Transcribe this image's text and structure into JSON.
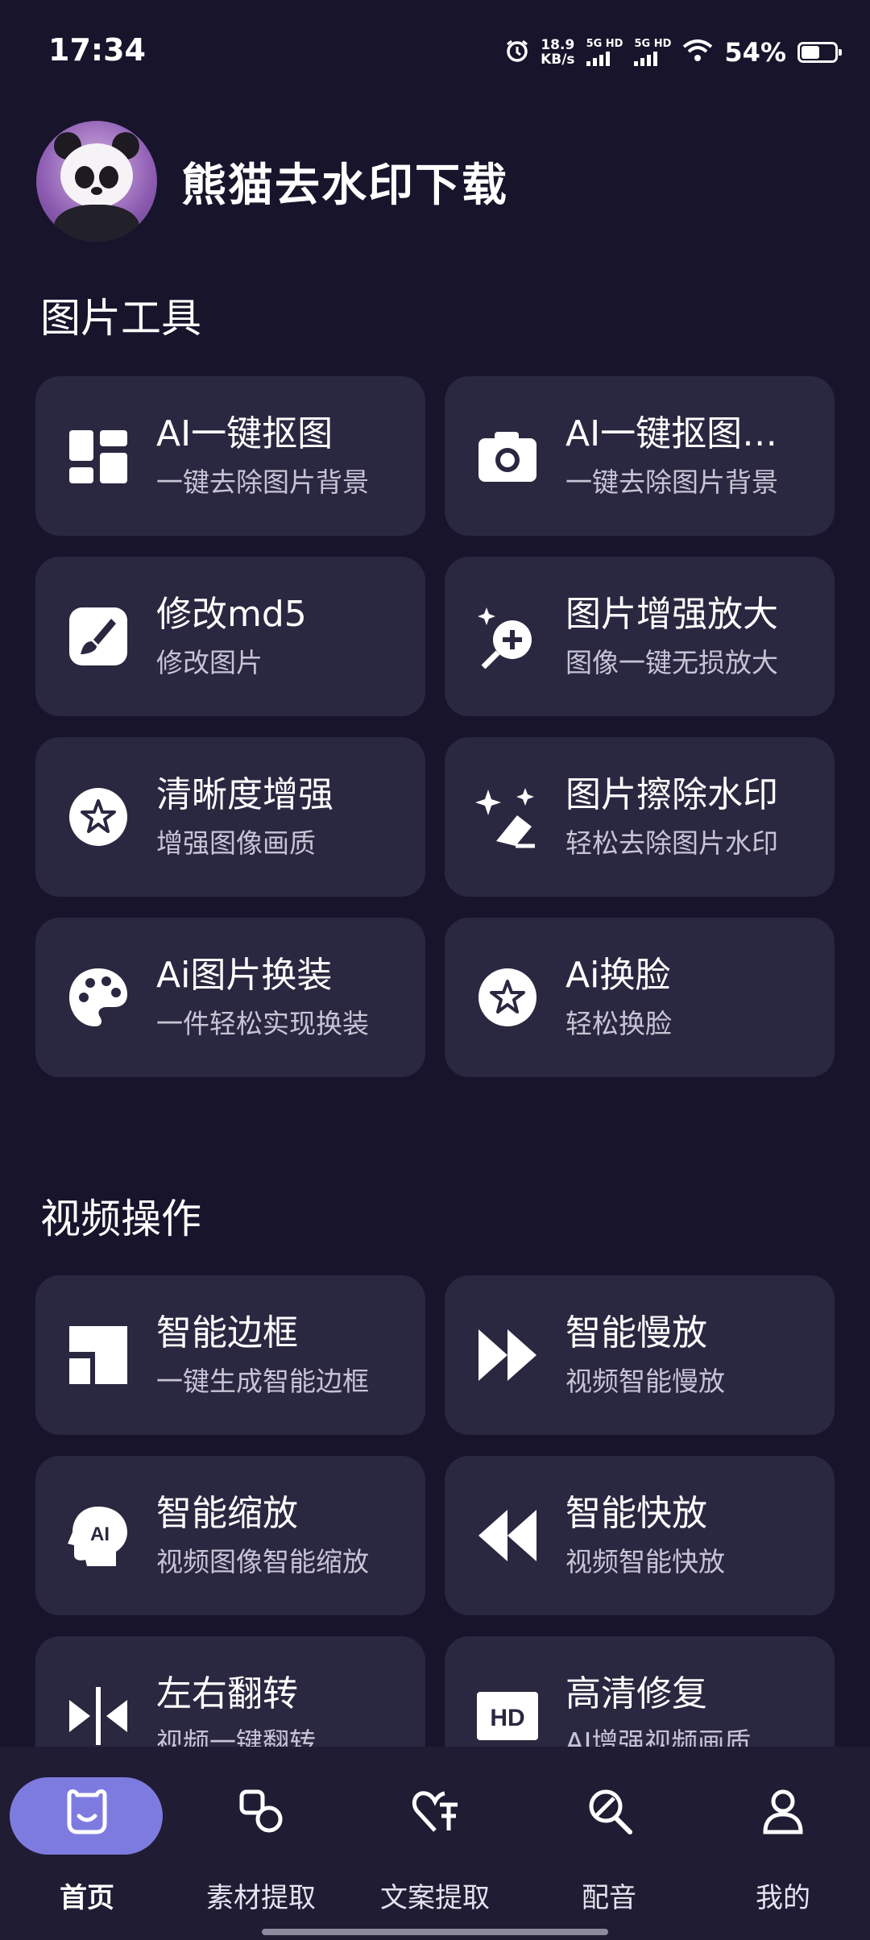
{
  "status_bar": {
    "time": "17:34",
    "net_speed_value": "18.9",
    "net_speed_unit": "KB/s",
    "signal1": "5G HD",
    "signal2": "5G HD",
    "battery": "54%",
    "battery_level": 0.54,
    "icons": [
      "alarm-icon",
      "wifi-icon",
      "battery-icon"
    ]
  },
  "header": {
    "app_title": "熊猫去水印下载",
    "avatar": "panda-avatar"
  },
  "image_tools": {
    "title": "图片工具",
    "items": [
      {
        "title": "AI一键抠图",
        "subtitle": "一键去除图片背景",
        "icon": "dashboard-icon"
      },
      {
        "title": "AI一键抠图…",
        "subtitle": "一键去除图片背景",
        "icon": "camera-icon"
      },
      {
        "title": "修改md5",
        "subtitle": "修改图片",
        "icon": "brush-icon"
      },
      {
        "title": "图片增强放大",
        "subtitle": "图像一键无损放大",
        "icon": "magic-zoom-icon"
      },
      {
        "title": "清晰度增强",
        "subtitle": "增强图像画质",
        "icon": "star-badge-icon"
      },
      {
        "title": "图片擦除水印",
        "subtitle": "轻松去除图片水印",
        "icon": "sparkle-eraser-icon"
      },
      {
        "title": "Ai图片换装",
        "subtitle": "一件轻松实现换装",
        "icon": "palette-icon"
      },
      {
        "title": "Ai换脸",
        "subtitle": "轻松换脸",
        "icon": "star-badge-icon"
      }
    ]
  },
  "video_tools": {
    "title": "视频操作",
    "items": [
      {
        "title": "智能边框",
        "subtitle": "一键生成智能边框",
        "icon": "frame-icon"
      },
      {
        "title": "智能慢放",
        "subtitle": "视频智能慢放",
        "icon": "fast-forward-icon"
      },
      {
        "title": "智能缩放",
        "subtitle": "视频图像智能缩放",
        "icon": "ai-head-icon"
      },
      {
        "title": "智能快放",
        "subtitle": "视频智能快放",
        "icon": "rewind-icon"
      },
      {
        "title": "左右翻转",
        "subtitle": "视频一键翻转",
        "icon": "flip-icon"
      },
      {
        "title": "高清修复",
        "subtitle": "AI增强视频画质",
        "icon": "hd-icon"
      }
    ]
  },
  "bottom_nav": {
    "items": [
      {
        "label": "首页",
        "icon": "home-bear-icon",
        "active": true
      },
      {
        "label": "素材提取",
        "icon": "shapes-icon",
        "active": false
      },
      {
        "label": "文案提取",
        "icon": "heart-text-icon",
        "active": false
      },
      {
        "label": "配音",
        "icon": "mic-icon",
        "active": false
      },
      {
        "label": "我的",
        "icon": "person-icon",
        "active": false
      }
    ]
  },
  "colors": {
    "background": "#17142b",
    "card": "#2a2740",
    "nav_background": "#1f1c33",
    "active_pill": "#7e7be0"
  }
}
